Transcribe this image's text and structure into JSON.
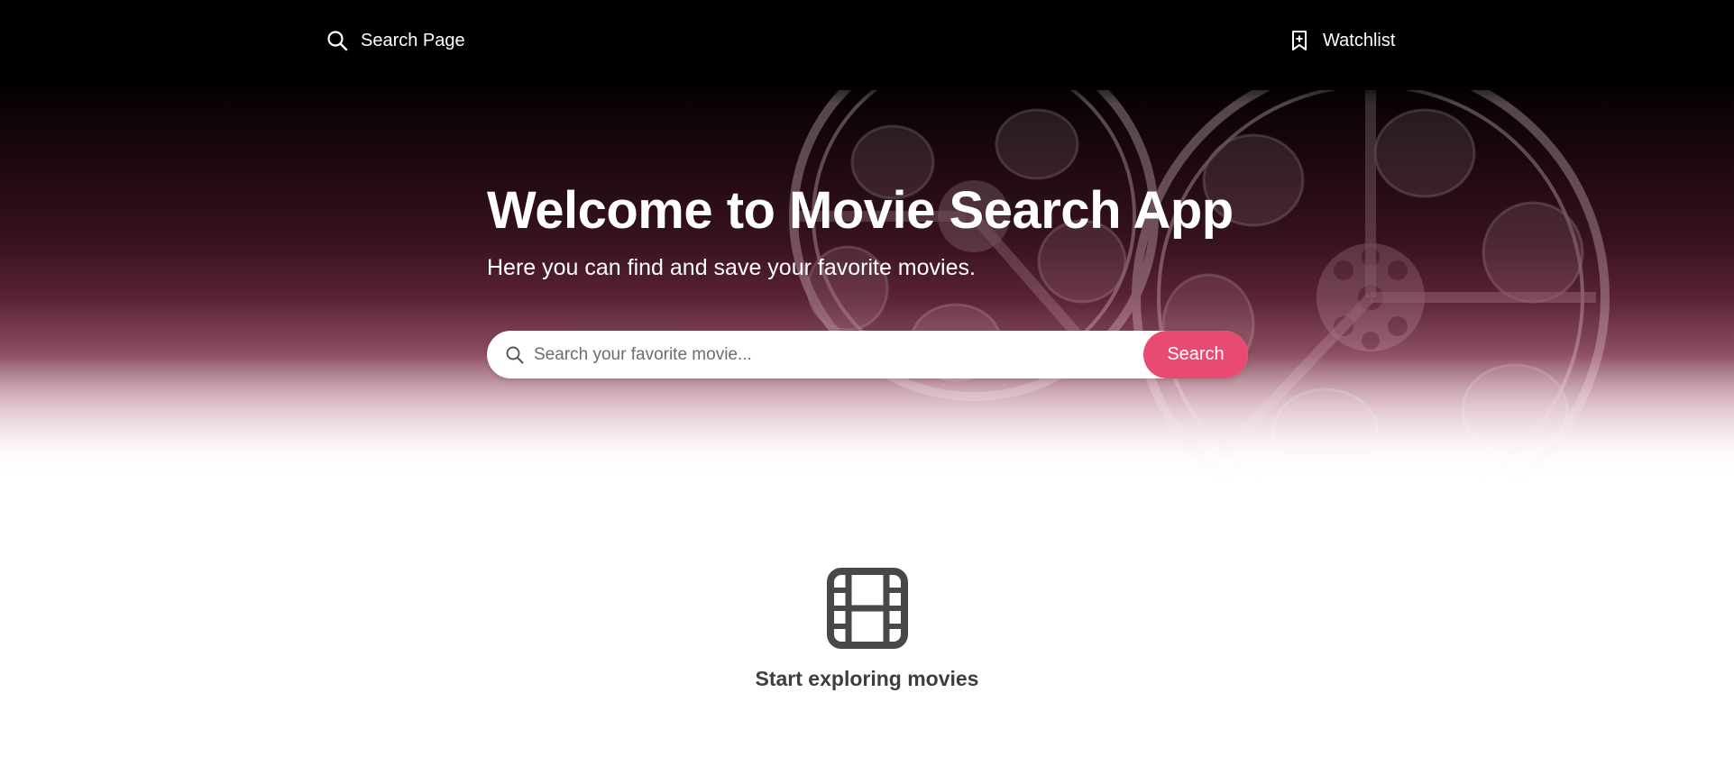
{
  "navbar": {
    "search_page_label": "Search Page",
    "watchlist_label": "Watchlist",
    "search_page_icon": "search-icon",
    "watchlist_icon": "bookmark-plus-icon"
  },
  "hero": {
    "title": "Welcome to Movie Search App",
    "subtitle": "Here you can find and save your favorite movies.",
    "background_image": "film-reel-image"
  },
  "search": {
    "placeholder": "Search your favorite movie...",
    "value": "",
    "button_label": "Search",
    "icon": "search-icon"
  },
  "empty_state": {
    "icon": "film-icon",
    "message": "Start exploring movies"
  },
  "colors": {
    "accent": "#e84a72",
    "nav_background": "#000000",
    "hero_tint": "#5a2236",
    "text_dark": "#3f3d40",
    "icon_gray": "#4a4749"
  }
}
